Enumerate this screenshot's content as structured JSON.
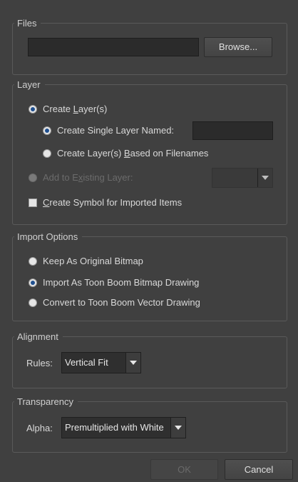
{
  "files": {
    "legend": "Files",
    "path_value": "",
    "browse_label": "Browse..."
  },
  "layer": {
    "legend": "Layer",
    "create_layers": {
      "pre": "Create ",
      "ul": "L",
      "post": "ayer(s)",
      "checked": true
    },
    "create_single": {
      "pre": "Create Sin",
      "ul": "g",
      "post": "le Layer Named:",
      "checked": true,
      "name_value": ""
    },
    "create_based": {
      "pre": "Create Layer(s) ",
      "ul": "B",
      "post": "ased on Filenames",
      "checked": false
    },
    "add_existing": {
      "pre": "Add to E",
      "ul": "x",
      "post": "isting Layer:",
      "checked": false,
      "disabled": true,
      "combo_value": ""
    },
    "create_symbol": {
      "pre": "",
      "ul": "C",
      "post": "reate Symbol for Imported Items",
      "checked": false
    }
  },
  "import_options": {
    "legend": "Import Options",
    "keep_original": {
      "label": "Keep As Original Bitmap",
      "checked": false
    },
    "toon_boom_bitmap": {
      "label": "Import As Toon Boom Bitmap Drawing",
      "checked": true
    },
    "toon_boom_vector": {
      "label": "Convert to Toon Boom Vector Drawing",
      "checked": false
    }
  },
  "alignment": {
    "legend": "Alignment",
    "rules_label": "Rules:",
    "rules_value": "Vertical Fit"
  },
  "transparency": {
    "legend": "Transparency",
    "alpha_label": "Alpha:",
    "alpha_value": "Premultiplied with White"
  },
  "footer": {
    "ok_label": "OK",
    "cancel_label": "Cancel"
  }
}
